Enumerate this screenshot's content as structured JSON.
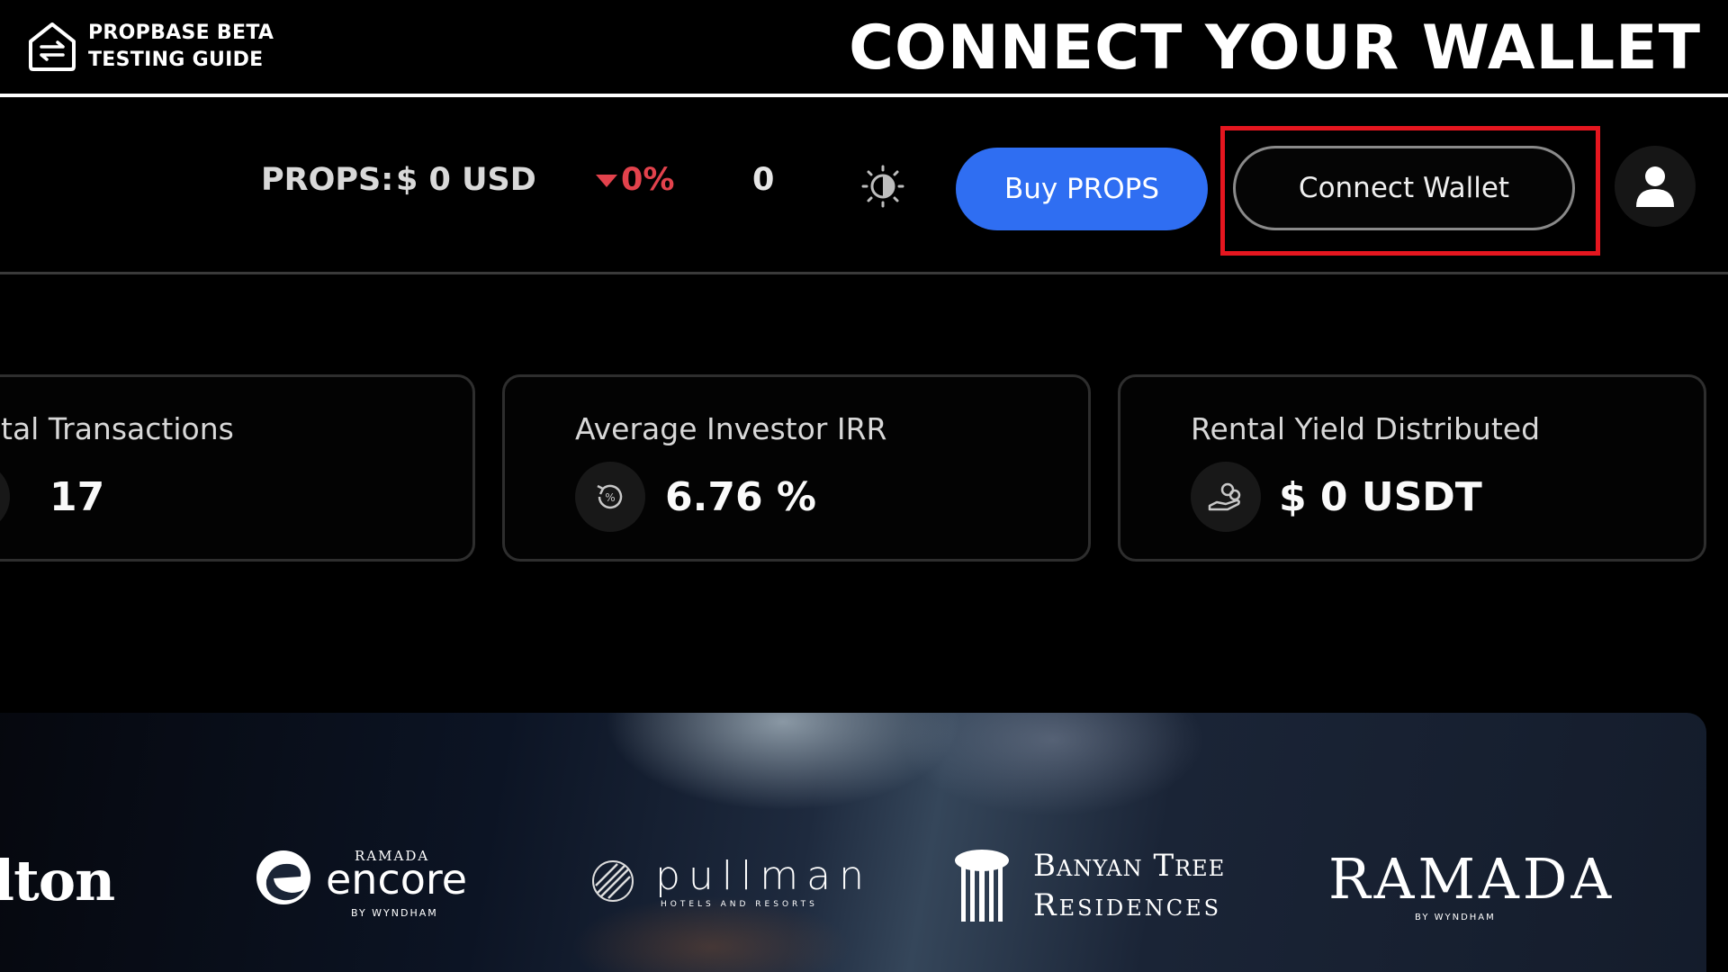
{
  "guide": {
    "brand_line1": "PROPBASE BETA",
    "brand_line2": "TESTING GUIDE",
    "title": "CONNECT YOUR WALLET"
  },
  "appbar": {
    "props_label": "PROPS:",
    "props_value": "$ 0 USD",
    "change": "0%",
    "change_direction": "down",
    "count": "0",
    "buy_label": "Buy PROPS",
    "connect_label": "Connect Wallet",
    "highlighted_element": "Connect Wallet",
    "colors": {
      "buy_button": "#2f6ef2",
      "change": "#e2424c",
      "highlight_box": "#e5161f"
    }
  },
  "stats": [
    {
      "title": "tal Transactions",
      "value": "17",
      "icon": "transactions-icon"
    },
    {
      "title": "Average Investor IRR",
      "value": "6.76 %",
      "icon": "percent-refresh-icon"
    },
    {
      "title": "Rental Yield Distributed",
      "value": "$ 0 USDT",
      "icon": "hand-coins-icon"
    }
  ],
  "partners": {
    "hilton": "ilton",
    "encore_top": "RAMADA",
    "encore_main": "encore",
    "encore_by": "BY WYNDHAM",
    "pullman_main": "pullman",
    "pullman_sub": "HOTELS AND RESORTS",
    "banyan_line1": "Banyan Tree",
    "banyan_line2": "Residences",
    "ramada_main": "RAMADA",
    "ramada_by": "BY WYNDHAM"
  }
}
